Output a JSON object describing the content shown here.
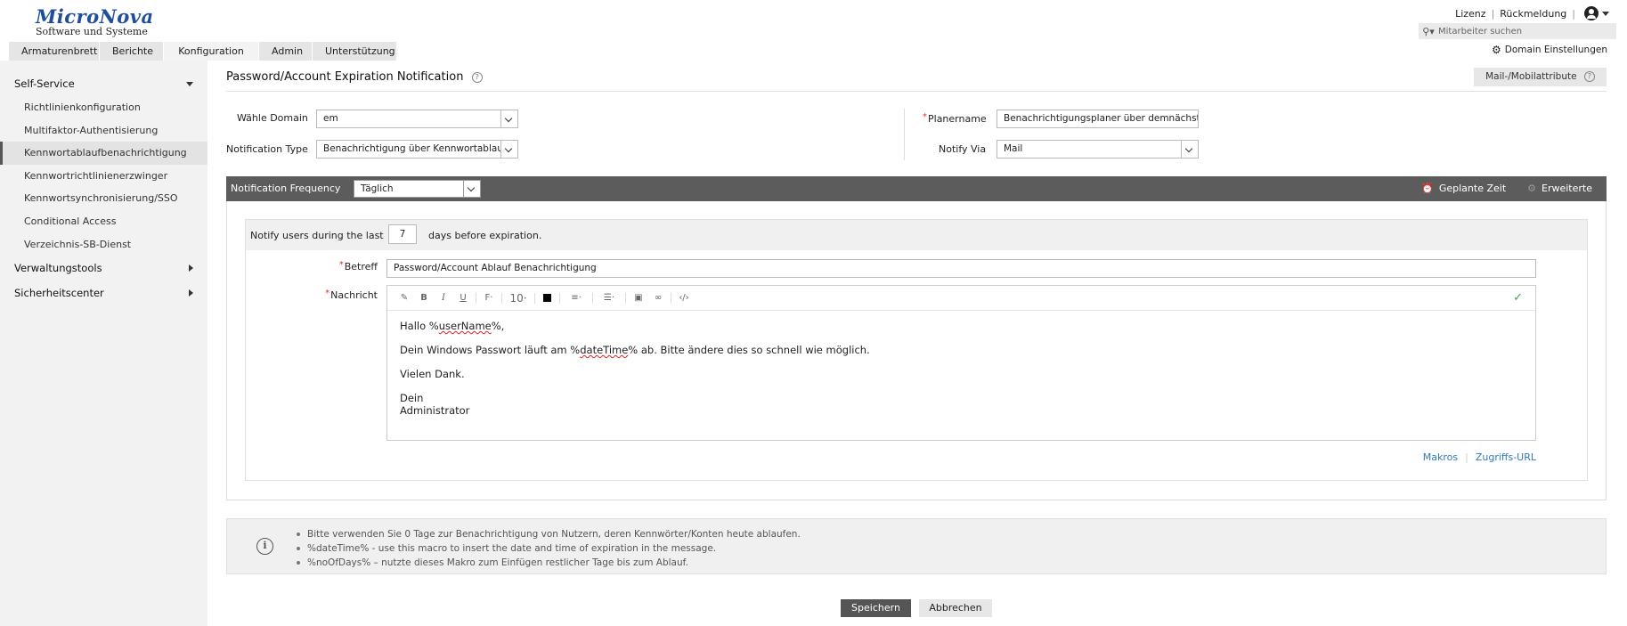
{
  "logo": {
    "main": "MicroNova",
    "sub": "Software und Systeme"
  },
  "top_links": {
    "license": "Lizenz",
    "feedback": "Rückmeldung"
  },
  "search": {
    "placeholder": "Mitarbeiter suchen"
  },
  "domain_settings": "Domain Einstellungen",
  "tabs": [
    "Armaturenbrett",
    "Berichte",
    "Konfiguration",
    "Admin",
    "Unterstützung"
  ],
  "active_tab": "Konfiguration",
  "sidebar": {
    "self_service": "Self-Service",
    "items": [
      "Richtlinienkonfiguration",
      "Multifaktor-Authentisierung",
      "Kennwortablaufbenachrichtigung",
      "Kennwortrichtlinienerzwinger",
      "Kennwortsynchronisierung/SSO",
      "Conditional Access",
      "Verzeichnis-SB-Dienst"
    ],
    "active_item": "Kennwortablaufbenachrichtigung",
    "admin_tools": "Verwaltungstools",
    "security_center": "Sicherheitscenter"
  },
  "page": {
    "title": "Password/Account Expiration Notification",
    "mail_attr_button": "Mail-/Mobilattribute"
  },
  "form": {
    "domain_label": "Wähle Domain",
    "domain_value": "em",
    "type_label": "Notification Type",
    "type_value": "Benachrichtigung über Kennwortablauf",
    "planner_label": "Planername",
    "planner_value": "Benachrichtigungsplaner über demnächst",
    "notify_via_label": "Notify Via",
    "notify_via_value": "Mail"
  },
  "frequency": {
    "label": "Notification Frequency",
    "value": "Täglich",
    "scheduled_time": "Geplante Zeit",
    "advanced": "Erweiterte"
  },
  "notify": {
    "before": "Notify users during the last",
    "days": "7",
    "after": "days before expiration."
  },
  "subject": {
    "label": "Betreff",
    "value": "Password/Account Ablauf Benachrichtigung"
  },
  "message": {
    "label": "Nachricht",
    "font_size": "10",
    "line1_pre": "Hallo %",
    "line1_macro": "userName",
    "line1_post": "%,",
    "line2_pre": "Dein Windows Passwort läuft am %",
    "line2_macro": "dateTime",
    "line2_post": "% ab. Bitte ändere dies so schnell wie möglich.",
    "line3": "Vielen Dank.",
    "line4": "Dein",
    "line5": "Administrator"
  },
  "links": {
    "macros": "Makros",
    "access_url": "Zugriffs-URL"
  },
  "info": [
    "Bitte verwenden Sie 0 Tage zur Benachrichtigung von Nutzern, deren Kennwörter/Konten heute ablaufen.",
    "%dateTime% - use this macro to insert the date and time of expiration in the message.",
    "%noOfDays% – nutzte dieses Makro zum Einfügen restlicher Tage bis zum Ablauf."
  ],
  "buttons": {
    "save": "Speichern",
    "cancel": "Abbrechen"
  },
  "colors": {
    "brand": "#1f4e9a",
    "bar": "#5c5c5c",
    "link": "#2f79c0",
    "success": "#3fa33f"
  }
}
